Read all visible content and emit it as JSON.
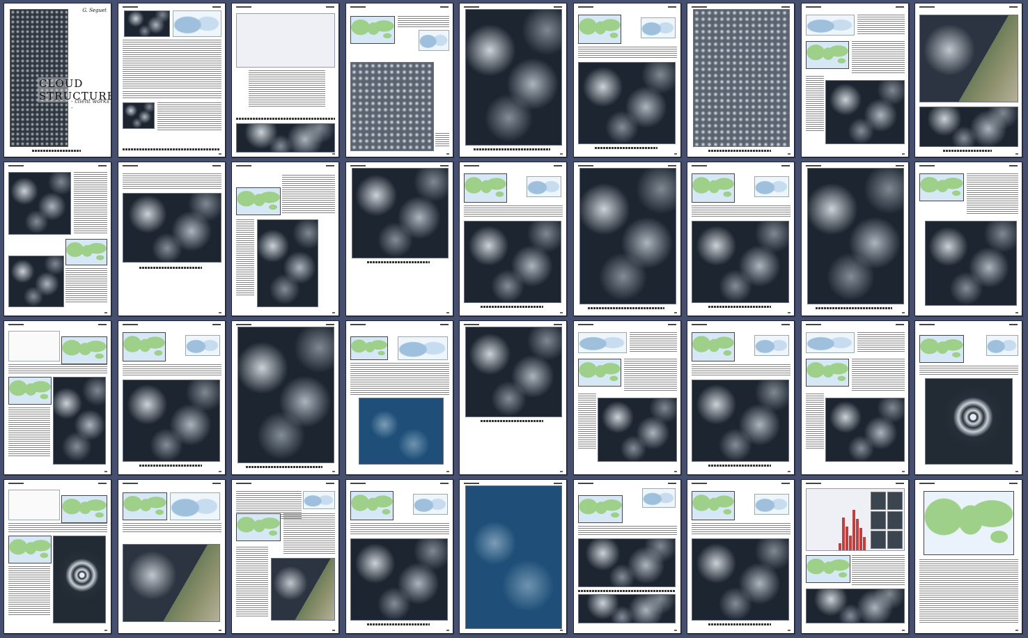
{
  "document": {
    "cover_title": "CLOUD STRUCTURES",
    "cover_subtitle": "- client works -",
    "cover_author": "G. Seguet"
  },
  "layout": {
    "columns": 9,
    "rows": 4
  },
  "pages": [
    {
      "kind": "cover"
    },
    {
      "kind": "text-top-img"
    },
    {
      "kind": "collage"
    },
    {
      "kind": "map-dense"
    },
    {
      "kind": "full-sat"
    },
    {
      "kind": "map-diagram-sat"
    },
    {
      "kind": "full-dense"
    },
    {
      "kind": "diagram-map-sat"
    },
    {
      "kind": "land-two"
    },
    {
      "kind": "dark-two"
    },
    {
      "kind": "text-sat"
    },
    {
      "kind": "map-narrow"
    },
    {
      "kind": "half-sat"
    },
    {
      "kind": "map-diagram-sat"
    },
    {
      "kind": "full-sat"
    },
    {
      "kind": "map-diagram-sat"
    },
    {
      "kind": "full-sat"
    },
    {
      "kind": "map-sat"
    },
    {
      "kind": "chart-map-sat"
    },
    {
      "kind": "map-diagram-sat"
    },
    {
      "kind": "full-sat"
    },
    {
      "kind": "map-diagram-ocean"
    },
    {
      "kind": "half-sat"
    },
    {
      "kind": "diagram-map-sat"
    },
    {
      "kind": "map-diagram-sat"
    },
    {
      "kind": "diagram-map-sat"
    },
    {
      "kind": "map-diagram-spiral"
    },
    {
      "kind": "chart-map-spiral"
    },
    {
      "kind": "map-diagram-land"
    },
    {
      "kind": "map-diagram-landright"
    },
    {
      "kind": "map-diagram-sat"
    },
    {
      "kind": "full-ocean"
    },
    {
      "kind": "diagram-map-two"
    },
    {
      "kind": "map-diagram-sat"
    },
    {
      "kind": "chart-thumbs-map"
    },
    {
      "kind": "worldmap-text"
    }
  ]
}
